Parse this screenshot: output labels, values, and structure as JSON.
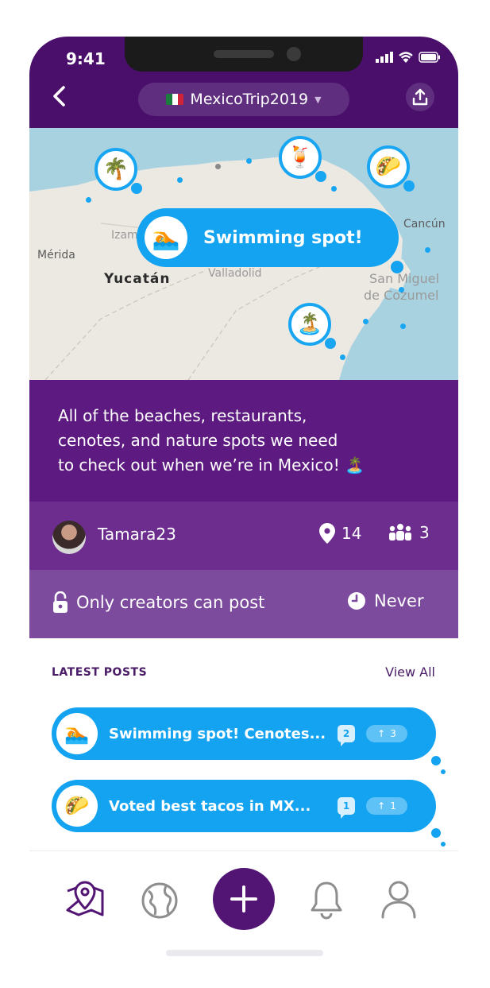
{
  "status_bar": {
    "time": "9:41"
  },
  "header": {
    "trip_name": "MexicoTrip2019"
  },
  "map": {
    "places": {
      "merida": "Mérida",
      "yucatan": "Yucatán",
      "izamal": "Izam",
      "valladolid": "Valladolid",
      "cancun": "Cancún",
      "san_miguel_1": "San Miguel",
      "san_miguel_2": "de Cozumel"
    },
    "callout": {
      "emoji": "🏊",
      "text": "Swimming spot!"
    },
    "pins": {
      "palm": "🌴",
      "cocktail": "🍹",
      "taco": "🌮",
      "island": "🏝️"
    }
  },
  "description": {
    "lines": [
      "All of the beaches, restaurants,",
      "cenotes, and nature spots we need",
      "to check out when we’re in Mexico! 🏝️"
    ]
  },
  "creator": {
    "username": "Tamara23",
    "spots_count": "14",
    "members_count": "3"
  },
  "permissions": {
    "post_permission": "Only creators can post",
    "expiry": "Never"
  },
  "latest_posts": {
    "heading": "LATEST POSTS",
    "view_all": "View All",
    "posts": [
      {
        "emoji": "🏊",
        "title": "Swimming spot! Cenotes...",
        "comments": "2",
        "votes": "3"
      },
      {
        "emoji": "🌮",
        "title": "Voted best tacos in MX...",
        "comments": "1",
        "votes": "1"
      }
    ]
  },
  "colors": {
    "header_purple": "#4a0f6b",
    "description_purple": "#5d1a80",
    "accent_blue": "#14a3f0",
    "map_water": "#a9d2e1",
    "map_land": "#ece9e2"
  }
}
